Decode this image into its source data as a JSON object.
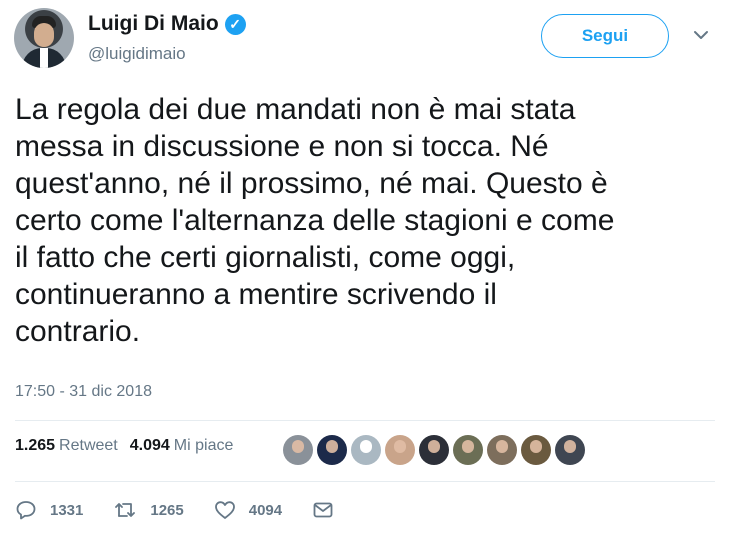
{
  "user": {
    "name": "Luigi Di Maio",
    "handle": "@luigidimaio",
    "verified_icon": "verified-badge-icon",
    "follow_label": "Segui",
    "accent": "#1da1f2"
  },
  "tweet": {
    "text": "La regola dei due mandati non è mai stata\nmessa in discussione e non si tocca. Né\nquest'anno, né il prossimo, né mai. Questo è\ncerto come l'alternanza delle stagioni e come\nil fatto che certi giornalisti, come oggi,\ncontinueranno a mentire scrivendo il\ncontrario.",
    "timestamp": "17:50 - 31 dic 2018"
  },
  "stats": {
    "retweets_count": "1.265",
    "retweets_label": "Retweet",
    "likes_count": "4.094",
    "likes_label": "Mi piace"
  },
  "likers": [
    {
      "color": "#8a9199"
    },
    {
      "color": "#1c2a4a"
    },
    {
      "color": "#aab8c2"
    },
    {
      "color": "#c9a48a"
    },
    {
      "color": "#2c2f38"
    },
    {
      "color": "#6b6e55"
    },
    {
      "color": "#7d6e5c"
    },
    {
      "color": "#6a5a3f"
    },
    {
      "color": "#3f4652"
    }
  ],
  "actions": {
    "reply_count": "1331",
    "retweet_count": "1265",
    "like_count": "4094"
  }
}
